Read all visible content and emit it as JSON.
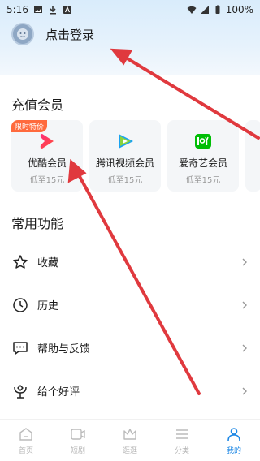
{
  "status_bar": {
    "time": "5:16",
    "battery": "100%"
  },
  "header": {
    "login_text": "点击登录"
  },
  "vip_section": {
    "title": "充值会员",
    "cards": [
      {
        "name": "优酷会员",
        "sub": "低至15元",
        "badge": "限时特价",
        "icon": "youku-icon"
      },
      {
        "name": "腾讯视频会员",
        "sub": "低至15元",
        "icon": "tencent-video-icon"
      },
      {
        "name": "爱奇艺会员",
        "sub": "低至15元",
        "icon": "iqiyi-icon"
      }
    ]
  },
  "functions": {
    "title": "常用功能",
    "items": [
      {
        "label": "收藏",
        "icon": "star-icon"
      },
      {
        "label": "历史",
        "icon": "clock-icon"
      },
      {
        "label": "帮助与反馈",
        "icon": "chat-icon"
      },
      {
        "label": "给个好评",
        "icon": "flower-icon"
      }
    ]
  },
  "tabbar": {
    "tabs": [
      {
        "label": "首页",
        "icon": "home-icon"
      },
      {
        "label": "短剧",
        "icon": "video-icon"
      },
      {
        "label": "逛逛",
        "icon": "crown-icon"
      },
      {
        "label": "分类",
        "icon": "menu-icon"
      },
      {
        "label": "我的",
        "icon": "person-icon",
        "active": true
      }
    ]
  },
  "colors": {
    "accent": "#1e88e5",
    "badge": "#ff6a3d",
    "arrow": "#e0393e"
  }
}
